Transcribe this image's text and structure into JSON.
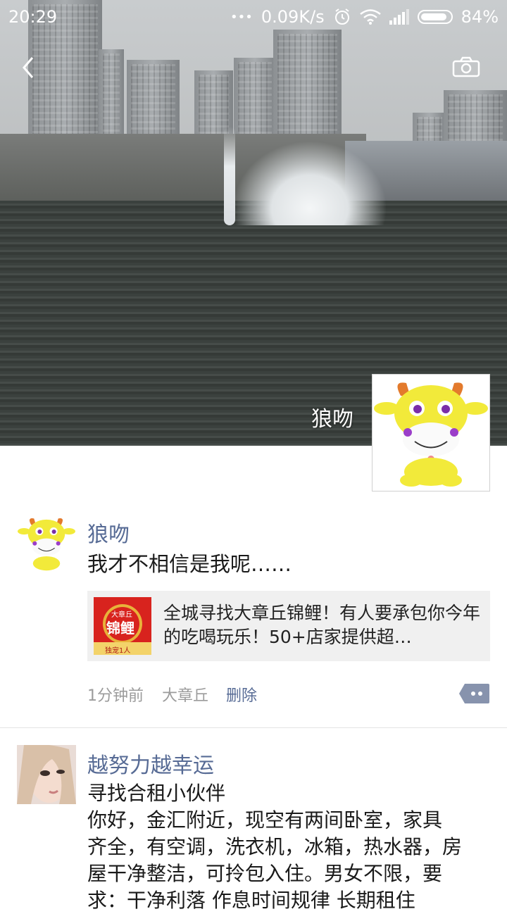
{
  "status_bar": {
    "time": "20:29",
    "dots": "•••",
    "speed": "0.09K/s",
    "battery": "84%"
  },
  "cover": {
    "owner_name": "狼吻"
  },
  "posts": [
    {
      "author": "狼吻",
      "text": "我才不相信是我呢……",
      "link": {
        "thumb_badge": "大章丘",
        "thumb_title": "锦鲤",
        "thumb_footer": "独宠1人",
        "title": "全城寻找大章丘锦鲤！有人要承包你今年的吃喝玩乐！50+店家提供超…"
      },
      "time": "1分钟前",
      "location": "大章丘",
      "delete_label": "删除"
    },
    {
      "author": "越努力越幸运",
      "text_lines": [
        "寻找合租小伙伴",
        "你好，金汇附近，现空有两间卧室，家具",
        "齐全，有空调，洗衣机，冰箱，热水器，房",
        "屋干净整洁，可拎包入住。男女不限，要",
        "求：干净利落 作息时间规律 长期租住"
      ]
    }
  ],
  "colors": {
    "nickname": "#576b95",
    "link_bg": "#f0f0f0",
    "meta_gray": "#9b9b9b"
  }
}
